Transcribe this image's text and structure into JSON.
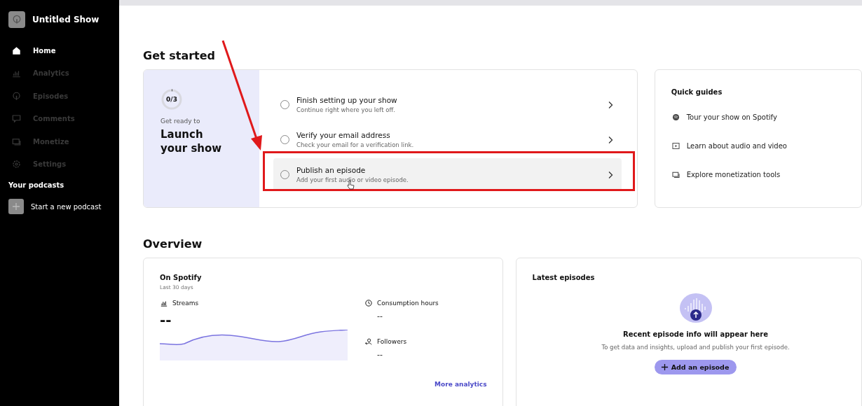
{
  "sidebar": {
    "show_title": "Untitled Show",
    "items": [
      {
        "label": "Home",
        "selected": true
      },
      {
        "label": "Analytics",
        "selected": false
      },
      {
        "label": "Episodes",
        "selected": false
      },
      {
        "label": "Comments",
        "selected": false
      },
      {
        "label": "Monetize",
        "selected": false
      },
      {
        "label": "Settings",
        "selected": false
      }
    ],
    "podcasts_heading": "Your podcasts",
    "new_podcast": "Start a new podcast"
  },
  "get_started": {
    "heading": "Get started",
    "progress": {
      "label": "0/3",
      "level": 0
    },
    "kicker": "Get ready to",
    "title": "Launch your show",
    "steps": [
      {
        "title": "Finish setting up your show",
        "subtitle": "Continue right where you left off.",
        "checked": false,
        "highlighted": false
      },
      {
        "title": "Verify your email address",
        "subtitle": "Check your email for a verification link.",
        "checked": false,
        "highlighted": false
      },
      {
        "title": "Publish an episode",
        "subtitle": "Add your first audio or video episode.",
        "checked": false,
        "highlighted": true
      }
    ]
  },
  "quick_guides": {
    "title": "Quick guides",
    "items": [
      {
        "label": "Tour your show on Spotify"
      },
      {
        "label": "Learn about audio and video"
      },
      {
        "label": "Explore monetization tools"
      }
    ]
  },
  "overview": {
    "heading": "Overview",
    "on_spotify": {
      "title": "On Spotify",
      "period": "Last 30 days",
      "streams_label": "Streams",
      "streams_value": "--",
      "metrics": [
        {
          "label": "Consumption hours",
          "value": "--"
        },
        {
          "label": "Followers",
          "value": "--"
        }
      ],
      "link": "More analytics"
    },
    "latest": {
      "title": "Latest episodes",
      "empty_title": "Recent episode info will appear here",
      "empty_text": "To get data and insights, upload and publish your first episode.",
      "button": "Add an episode"
    }
  }
}
